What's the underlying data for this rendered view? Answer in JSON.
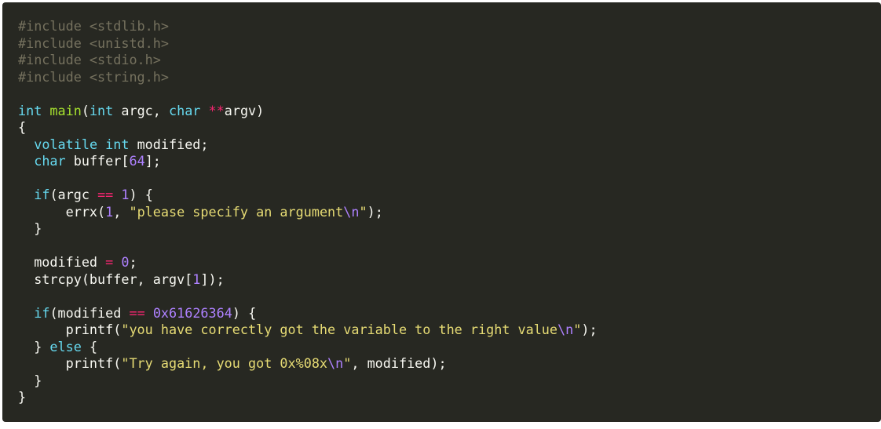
{
  "colors": {
    "background": "#272822",
    "comment": "#75715e",
    "keyword": "#66d9ef",
    "function": "#a6e22e",
    "number": "#ae81ff",
    "string": "#e6db74",
    "operator": "#f92672",
    "escape": "#ae81ff",
    "plain": "#f8f8f2"
  },
  "code": {
    "language": "c",
    "lines": [
      [
        {
          "t": "comment",
          "v": "#include <stdlib.h>"
        }
      ],
      [
        {
          "t": "comment",
          "v": "#include <unistd.h>"
        }
      ],
      [
        {
          "t": "comment",
          "v": "#include <stdio.h>"
        }
      ],
      [
        {
          "t": "comment",
          "v": "#include <string.h>"
        }
      ],
      [],
      [
        {
          "t": "keyword",
          "v": "int"
        },
        {
          "t": "plain",
          "v": " "
        },
        {
          "t": "function",
          "v": "main"
        },
        {
          "t": "plain",
          "v": "("
        },
        {
          "t": "keyword",
          "v": "int"
        },
        {
          "t": "plain",
          "v": " argc, "
        },
        {
          "t": "keyword",
          "v": "char"
        },
        {
          "t": "plain",
          "v": " "
        },
        {
          "t": "operator",
          "v": "**"
        },
        {
          "t": "plain",
          "v": "argv)"
        }
      ],
      [
        {
          "t": "plain",
          "v": "{"
        }
      ],
      [
        {
          "t": "plain",
          "v": "  "
        },
        {
          "t": "keyword",
          "v": "volatile"
        },
        {
          "t": "plain",
          "v": " "
        },
        {
          "t": "keyword",
          "v": "int"
        },
        {
          "t": "plain",
          "v": " modified;"
        }
      ],
      [
        {
          "t": "plain",
          "v": "  "
        },
        {
          "t": "keyword",
          "v": "char"
        },
        {
          "t": "plain",
          "v": " buffer["
        },
        {
          "t": "number",
          "v": "64"
        },
        {
          "t": "plain",
          "v": "];"
        }
      ],
      [],
      [
        {
          "t": "plain",
          "v": "  "
        },
        {
          "t": "keyword",
          "v": "if"
        },
        {
          "t": "plain",
          "v": "(argc "
        },
        {
          "t": "operator",
          "v": "=="
        },
        {
          "t": "plain",
          "v": " "
        },
        {
          "t": "number",
          "v": "1"
        },
        {
          "t": "plain",
          "v": ") {"
        }
      ],
      [
        {
          "t": "plain",
          "v": "      errx("
        },
        {
          "t": "number",
          "v": "1"
        },
        {
          "t": "plain",
          "v": ", "
        },
        {
          "t": "string",
          "v": "\"please specify an argument"
        },
        {
          "t": "escape",
          "v": "\\n"
        },
        {
          "t": "string",
          "v": "\""
        },
        {
          "t": "plain",
          "v": ");"
        }
      ],
      [
        {
          "t": "plain",
          "v": "  }"
        }
      ],
      [],
      [
        {
          "t": "plain",
          "v": "  modified "
        },
        {
          "t": "operator",
          "v": "="
        },
        {
          "t": "plain",
          "v": " "
        },
        {
          "t": "number",
          "v": "0"
        },
        {
          "t": "plain",
          "v": ";"
        }
      ],
      [
        {
          "t": "plain",
          "v": "  strcpy(buffer, argv["
        },
        {
          "t": "number",
          "v": "1"
        },
        {
          "t": "plain",
          "v": "]);"
        }
      ],
      [],
      [
        {
          "t": "plain",
          "v": "  "
        },
        {
          "t": "keyword",
          "v": "if"
        },
        {
          "t": "plain",
          "v": "(modified "
        },
        {
          "t": "operator",
          "v": "=="
        },
        {
          "t": "plain",
          "v": " "
        },
        {
          "t": "number",
          "v": "0x61626364"
        },
        {
          "t": "plain",
          "v": ") {"
        }
      ],
      [
        {
          "t": "plain",
          "v": "      printf("
        },
        {
          "t": "string",
          "v": "\"you have correctly got the variable to the right value"
        },
        {
          "t": "escape",
          "v": "\\n"
        },
        {
          "t": "string",
          "v": "\""
        },
        {
          "t": "plain",
          "v": ");"
        }
      ],
      [
        {
          "t": "plain",
          "v": "  } "
        },
        {
          "t": "keyword",
          "v": "else"
        },
        {
          "t": "plain",
          "v": " {"
        }
      ],
      [
        {
          "t": "plain",
          "v": "      printf("
        },
        {
          "t": "string",
          "v": "\"Try again, you got 0x%08x"
        },
        {
          "t": "escape",
          "v": "\\n"
        },
        {
          "t": "string",
          "v": "\""
        },
        {
          "t": "plain",
          "v": ", modified);"
        }
      ],
      [
        {
          "t": "plain",
          "v": "  }"
        }
      ],
      [
        {
          "t": "plain",
          "v": "}"
        }
      ]
    ]
  }
}
